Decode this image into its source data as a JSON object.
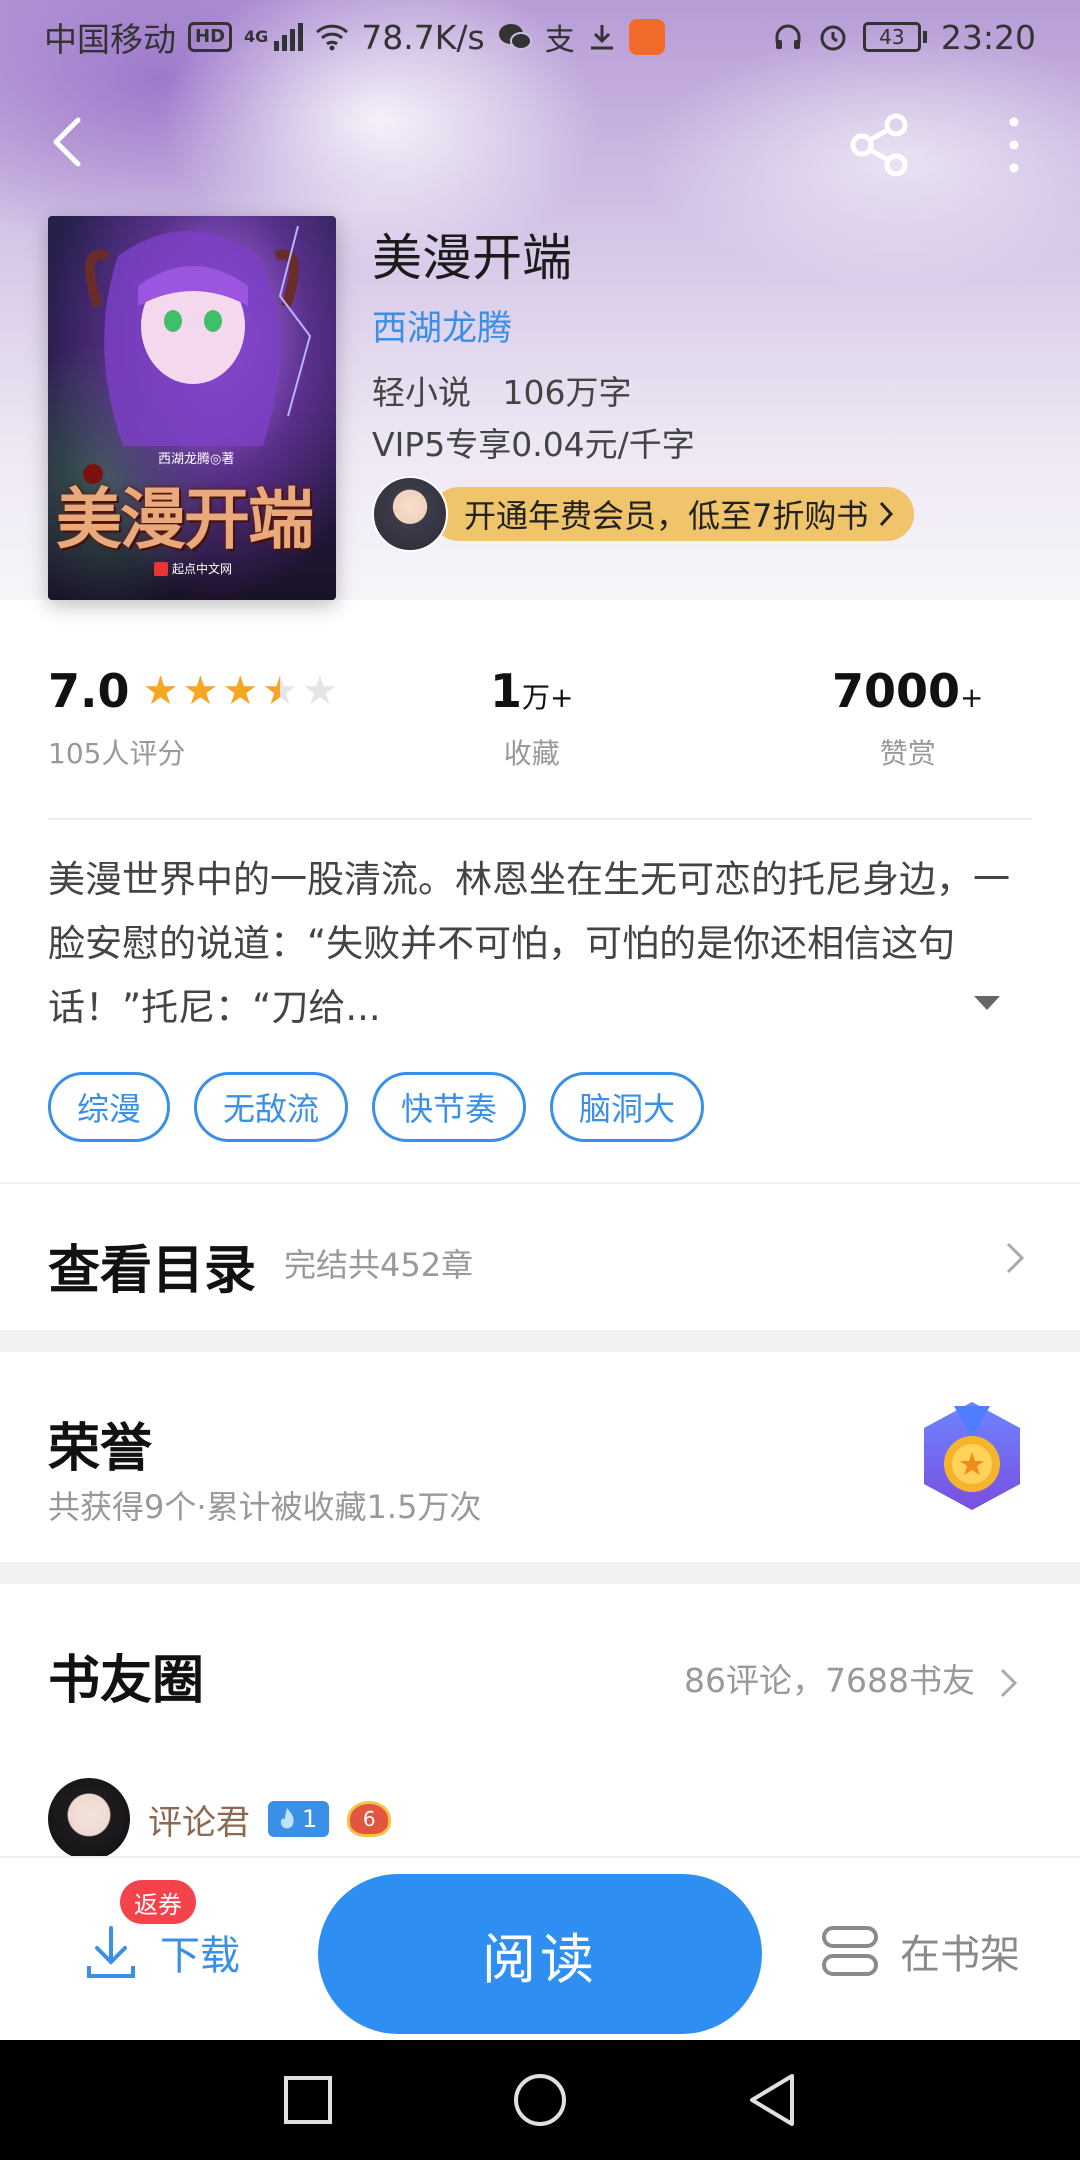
{
  "status_bar": {
    "carrier": "中国移动",
    "hd": "HD",
    "network": "4G",
    "speed": "78.7K/s",
    "battery": "43",
    "time": "23:20"
  },
  "topnav": {
    "back_icon": "chevron-left-icon",
    "share_icon": "share-icon",
    "more_icon": "more-vertical-icon"
  },
  "book": {
    "cover": {
      "author_mini": "西湖龙腾◎著",
      "title_art": "美漫开端",
      "publisher": "起点中文网"
    },
    "title": "美漫开端",
    "author": "西湖龙腾",
    "meta": "轻小说   106万字",
    "price": "VIP5专享0.04元/千字",
    "vip_promo": "开通年费会员，低至7折购书"
  },
  "stats": {
    "rating": "7.0",
    "stars": 3.5,
    "rating_count": "105人评分",
    "favorites_num": "1",
    "favorites_unit": "万+",
    "favorites_label": "收藏",
    "tips_num": "7000",
    "tips_unit": "+",
    "tips_label": "赞赏"
  },
  "synopsis": "美漫世界中的一股清流。林恩坐在生无可恋的托尼身边，一脸安慰的说道：“失败并不可怕，可怕的是你还相信这句话！”托尼：“刀给...",
  "tags": [
    "综漫",
    "无敌流",
    "快节奏",
    "脑洞大"
  ],
  "toc": {
    "title": "查看目录",
    "subtitle": "完结共452章"
  },
  "honor": {
    "title": "荣誉",
    "subtitle": "共获得9个·累计被收藏1.5万次"
  },
  "circle": {
    "title": "书友圈",
    "subtitle": "86评论，7688书友",
    "commenter_name": "评论君",
    "fire_level": "1",
    "user_level": "6"
  },
  "bottom": {
    "download_badge": "返券",
    "download": "下载",
    "read": "阅读",
    "shelf": "在书架"
  },
  "colors": {
    "accent": "#3a8fe6",
    "read_button": "#2e8ef2",
    "star": "#f6a623",
    "vip_bar": "#f0c46a",
    "badge_red": "#f5434b"
  }
}
